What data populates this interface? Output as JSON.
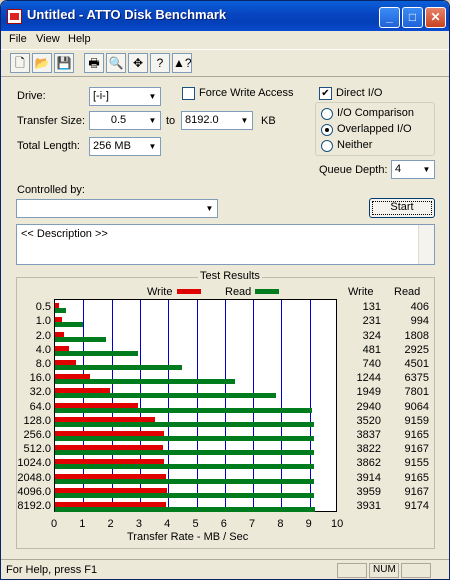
{
  "window": {
    "title": "Untitled - ATTO Disk Benchmark",
    "min": "_",
    "max": "□",
    "close": "✕"
  },
  "menu": [
    "File",
    "View",
    "Help"
  ],
  "toolbar": {
    "icons": [
      "new-icon",
      "open-icon",
      "save-icon",
      "print-icon",
      "print-preview-icon",
      "move-icon",
      "help-icon",
      "context-help-icon"
    ],
    "glyphs": [
      "🗋",
      "📂",
      "💾",
      "🖶",
      "🔍",
      "✥",
      "?",
      "▲?"
    ]
  },
  "form": {
    "drive_label": "Drive:",
    "drive_value": "[-i-]",
    "transfer_label": "Transfer Size:",
    "transfer_from": "0.5",
    "to_label": "to",
    "transfer_to": "8192.0",
    "kb_label": "KB",
    "length_label": "Total Length:",
    "length_value": "256 MB",
    "force_write_label": "Force Write Access",
    "force_write_checked": false,
    "direct_io_label": "Direct I/O",
    "direct_io_checked": true,
    "io_comparison_label": "I/O Comparison",
    "overlapped_label": "Overlapped I/O",
    "neither_label": "Neither",
    "selected_mode": "overlapped",
    "queue_label": "Queue Depth:",
    "queue_value": "4",
    "controlled_label": "Controlled by:",
    "controlled_value": "",
    "start_label": "Start",
    "description": "<< Description >>"
  },
  "results": {
    "title": "Test Results",
    "write_legend": "Write",
    "read_legend": "Read",
    "col_write": "Write",
    "col_read": "Read",
    "xlabel": "Transfer Rate - MB / Sec",
    "colors": {
      "write": "#e00000",
      "read": "#007c1e",
      "grid": "#0000c8"
    }
  },
  "chart_data": {
    "type": "bar",
    "orientation": "horizontal",
    "title": "Test Results",
    "xlabel": "Transfer Rate - MB / Sec",
    "xlim": [
      0,
      10
    ],
    "xticks": [
      "0",
      "1",
      "2",
      "3",
      "4",
      "5",
      "6",
      "7",
      "8",
      "9",
      "10"
    ],
    "categories": [
      "0.5",
      "1.0",
      "2.0",
      "4.0",
      "8.0",
      "16.0",
      "32.0",
      "64.0",
      "128.0",
      "256.0",
      "512.0",
      "1024.0",
      "2048.0",
      "4096.0",
      "8192.0"
    ],
    "series": [
      {
        "name": "Write",
        "values": [
          131,
          231,
          324,
          481,
          740,
          1244,
          1949,
          2940,
          3520,
          3837,
          3822,
          3862,
          3914,
          3959,
          3931
        ]
      },
      {
        "name": "Read",
        "values": [
          406,
          994,
          1808,
          2925,
          4501,
          6375,
          7801,
          9064,
          9159,
          9165,
          9167,
          9155,
          9165,
          9167,
          9174
        ]
      }
    ]
  },
  "status": {
    "help": "For Help, press F1",
    "num": "NUM"
  }
}
